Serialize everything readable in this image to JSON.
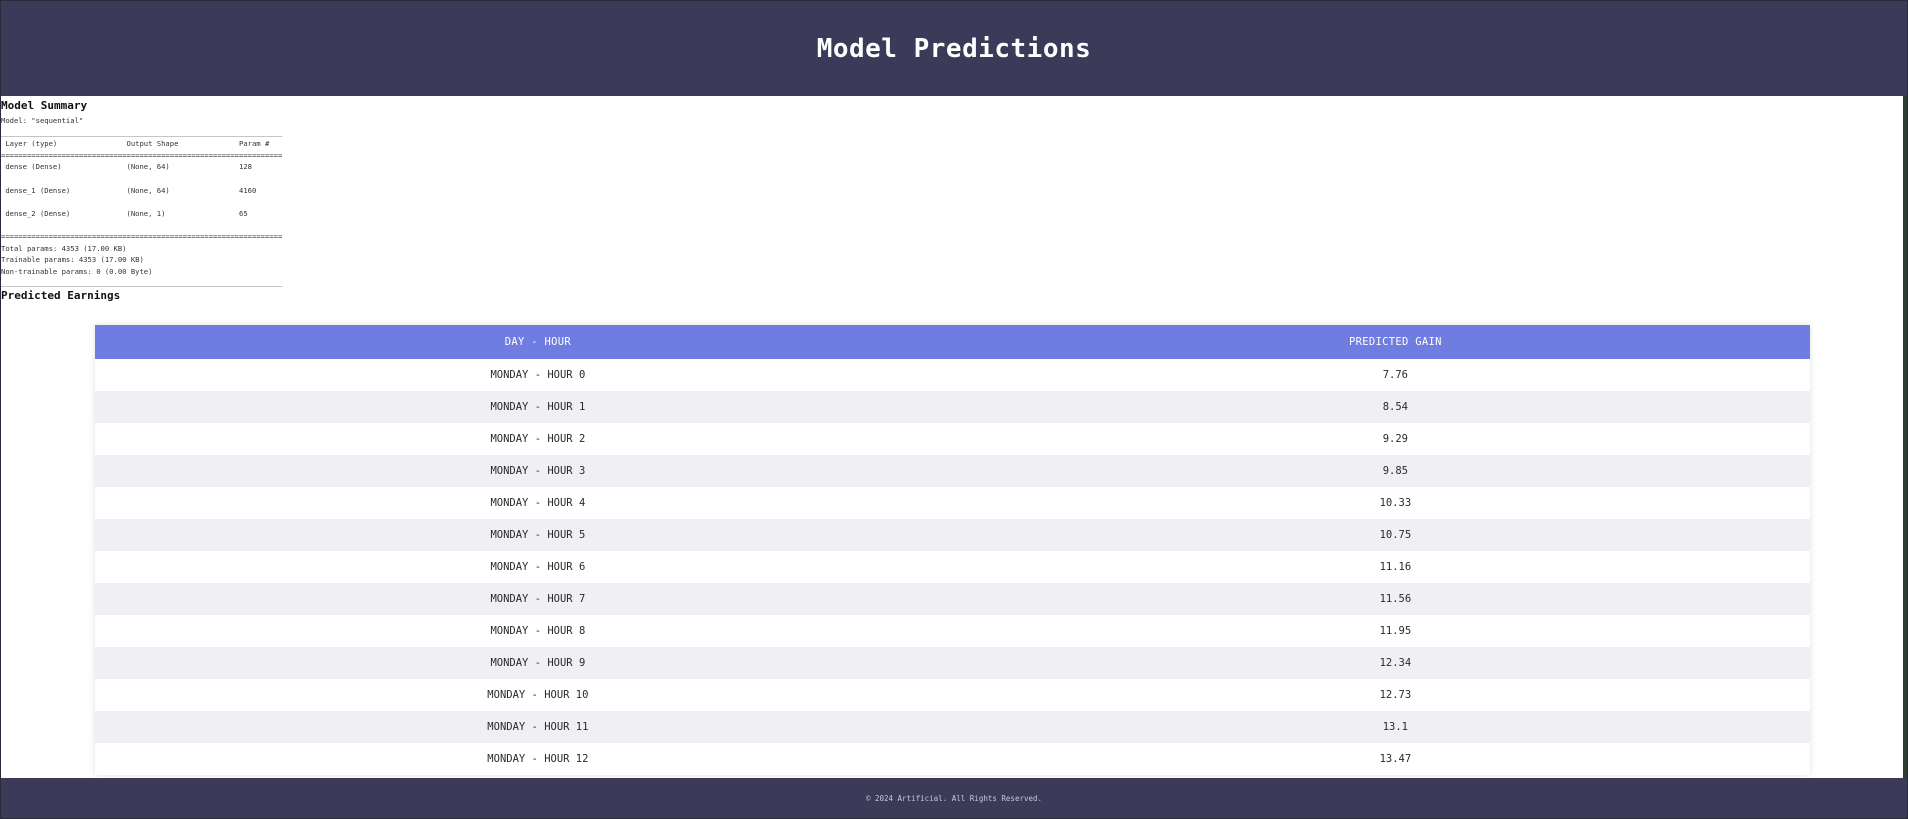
{
  "header": {
    "title": "Model Predictions"
  },
  "summary": {
    "title": "Model Summary",
    "text": "Model: \"sequential\"\n_________________________________________________________________\n Layer (type)                Output Shape              Param #\n=================================================================\n dense (Dense)               (None, 64)                128\n\n dense_1 (Dense)             (None, 64)                4160\n\n dense_2 (Dense)             (None, 1)                 65\n\n=================================================================\nTotal params: 4353 (17.00 KB)\nTrainable params: 4353 (17.00 KB)\nNon-trainable params: 0 (0.00 Byte)\n_________________________________________________________________"
  },
  "predictions": {
    "title": "Predicted Earnings",
    "col_day_hour": "DAY - HOUR",
    "col_gain": "PREDICTED GAIN",
    "rows": [
      {
        "day_hour": "MONDAY - HOUR 0",
        "gain": "7.76"
      },
      {
        "day_hour": "MONDAY - HOUR 1",
        "gain": "8.54"
      },
      {
        "day_hour": "MONDAY - HOUR 2",
        "gain": "9.29"
      },
      {
        "day_hour": "MONDAY - HOUR 3",
        "gain": "9.85"
      },
      {
        "day_hour": "MONDAY - HOUR 4",
        "gain": "10.33"
      },
      {
        "day_hour": "MONDAY - HOUR 5",
        "gain": "10.75"
      },
      {
        "day_hour": "MONDAY - HOUR 6",
        "gain": "11.16"
      },
      {
        "day_hour": "MONDAY - HOUR 7",
        "gain": "11.56"
      },
      {
        "day_hour": "MONDAY - HOUR 8",
        "gain": "11.95"
      },
      {
        "day_hour": "MONDAY - HOUR 9",
        "gain": "12.34"
      },
      {
        "day_hour": "MONDAY - HOUR 10",
        "gain": "12.73"
      },
      {
        "day_hour": "MONDAY - HOUR 11",
        "gain": "13.1"
      },
      {
        "day_hour": "MONDAY - HOUR 12",
        "gain": "13.47"
      }
    ]
  },
  "footer": {
    "text": "© 2024 Artificial. All Rights Reserved."
  }
}
